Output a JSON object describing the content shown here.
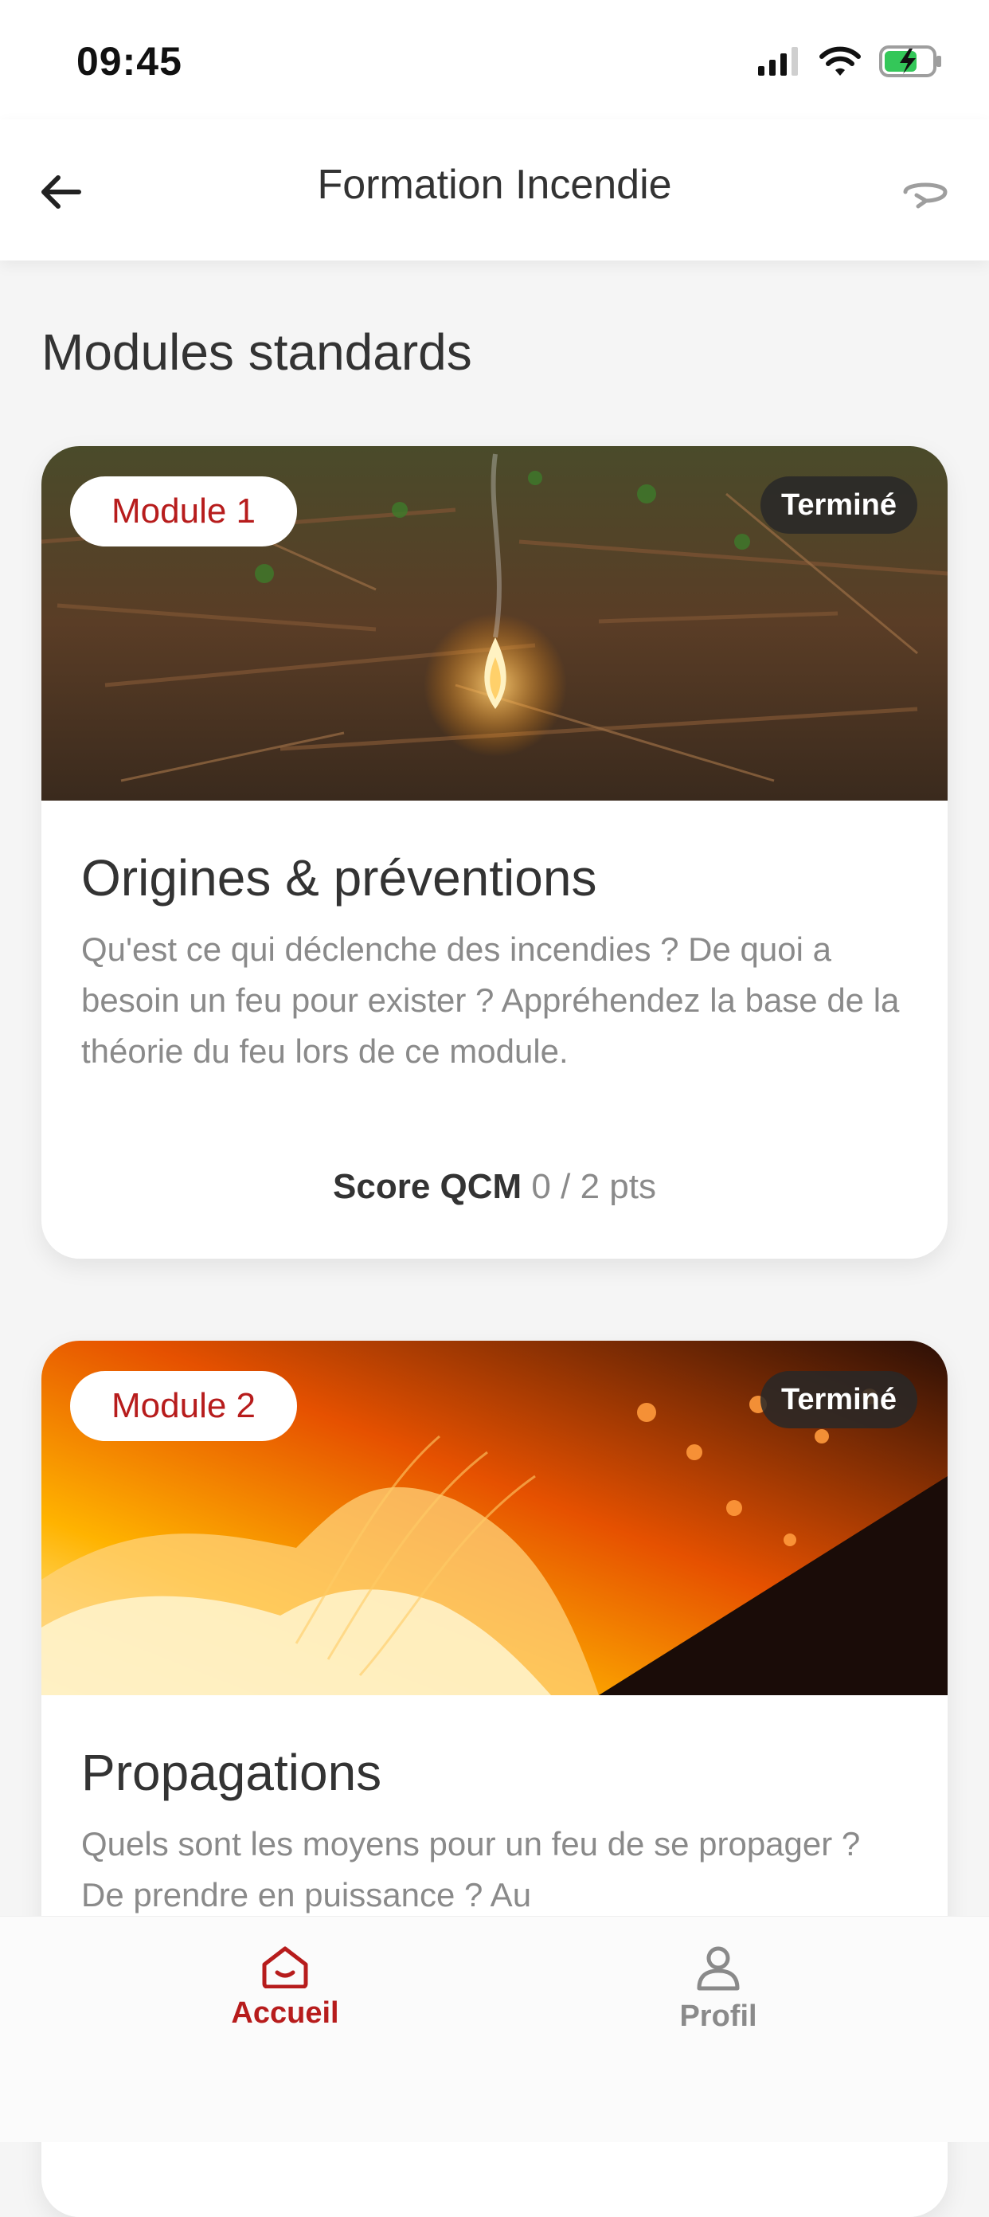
{
  "status_bar": {
    "time": "09:45",
    "icons": [
      "signal-icon",
      "wifi-icon",
      "battery-charging-icon"
    ]
  },
  "header": {
    "title": "Formation Incendie",
    "icons": {
      "left": "back-arrow-icon",
      "right": "rotate-icon"
    }
  },
  "section": {
    "title": "Modules standards"
  },
  "modules": [
    {
      "badge": "Module 1",
      "status": "Terminé",
      "title": "Origines & préventions",
      "description": "Qu'est ce qui déclenche des incendies ? De quoi a besoin un feu pour exister ? Appréhendez la base de la théorie du feu lors de ce module.",
      "score_label": "Score QCM",
      "score_value": "0 / 2 pts"
    },
    {
      "badge": "Module 2",
      "status": "Terminé",
      "title": "Propagations",
      "description": "Quels sont les moyens pour un feu de se propager ? De prendre en puissance ? Au"
    }
  ],
  "tabbar": {
    "home": "Accueil",
    "profile": "Profil"
  },
  "colors": {
    "accent": "#b71c1c",
    "muted_text": "#8a8a8a",
    "dark_text": "#333333",
    "background": "#f5f5f5"
  }
}
